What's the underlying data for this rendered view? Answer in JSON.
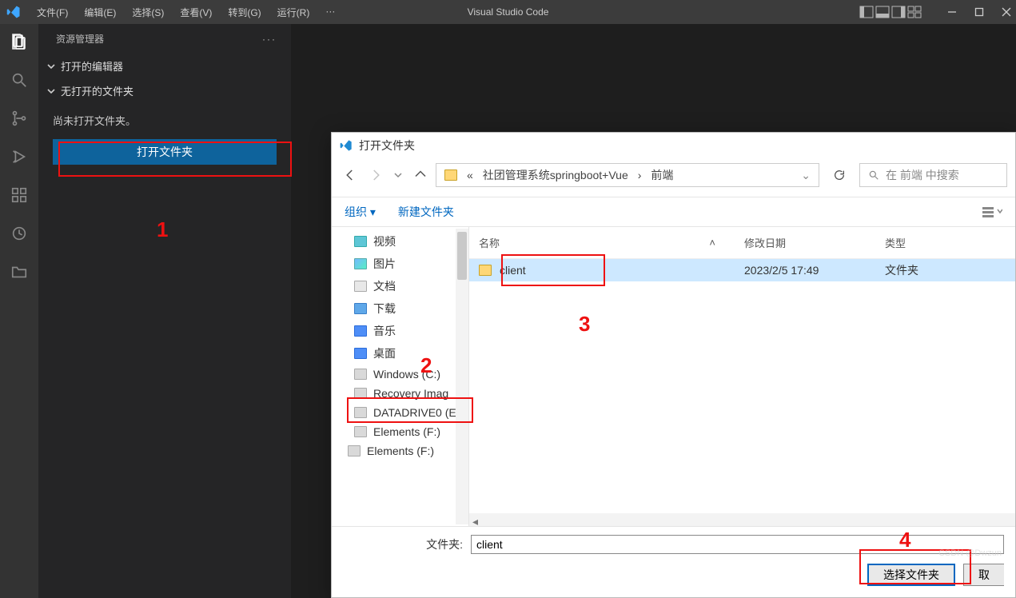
{
  "titlebar": {
    "title": "Visual Studio Code",
    "menus": [
      "文件(F)",
      "编辑(E)",
      "选择(S)",
      "查看(V)",
      "转到(G)",
      "运行(R)",
      "···"
    ]
  },
  "sidebar": {
    "header": "资源管理器",
    "sections": {
      "openEditors": "打开的编辑器",
      "noFolder": "无打开的文件夹"
    },
    "message": "尚未打开文件夹。",
    "openFolderButton": "打开文件夹"
  },
  "dialog": {
    "title": "打开文件夹",
    "breadcrumb": {
      "sep": "«",
      "p1": "社团管理系统springboot+Vue",
      "p2": "前端"
    },
    "searchPlaceholder": "在 前端 中搜索",
    "toolbar": {
      "organize": "组织 ▾",
      "newFolder": "新建文件夹"
    },
    "tree": [
      {
        "label": "视频",
        "icon": "ic-vid"
      },
      {
        "label": "图片",
        "icon": "ic-pic"
      },
      {
        "label": "文档",
        "icon": "ic-doc"
      },
      {
        "label": "下载",
        "icon": "ic-dl"
      },
      {
        "label": "音乐",
        "icon": "ic-music"
      },
      {
        "label": "桌面",
        "icon": "ic-desk"
      },
      {
        "label": "Windows (C:)",
        "icon": "ic-drive"
      },
      {
        "label": "Recovery Imag",
        "icon": "ic-drive"
      },
      {
        "label": "DATADRIVE0 (E",
        "icon": "ic-drive"
      },
      {
        "label": "Elements (F:)",
        "icon": "ic-drive"
      },
      {
        "label": "Elements (F:)",
        "icon": "ic-drive"
      }
    ],
    "columns": {
      "name": "名称",
      "date": "修改日期",
      "type": "类型"
    },
    "rows": [
      {
        "name": "client",
        "date": "2023/2/5 17:49",
        "type": "文件夹",
        "selected": true
      }
    ],
    "footer": {
      "label": "文件夹:",
      "value": "client",
      "selectBtn": "选择文件夹",
      "cancelBtn": "取"
    }
  },
  "annotations": {
    "l1": "1",
    "l2": "2",
    "l3": "3",
    "l4": "4"
  },
  "watermark": "CSDN @Dwzun"
}
